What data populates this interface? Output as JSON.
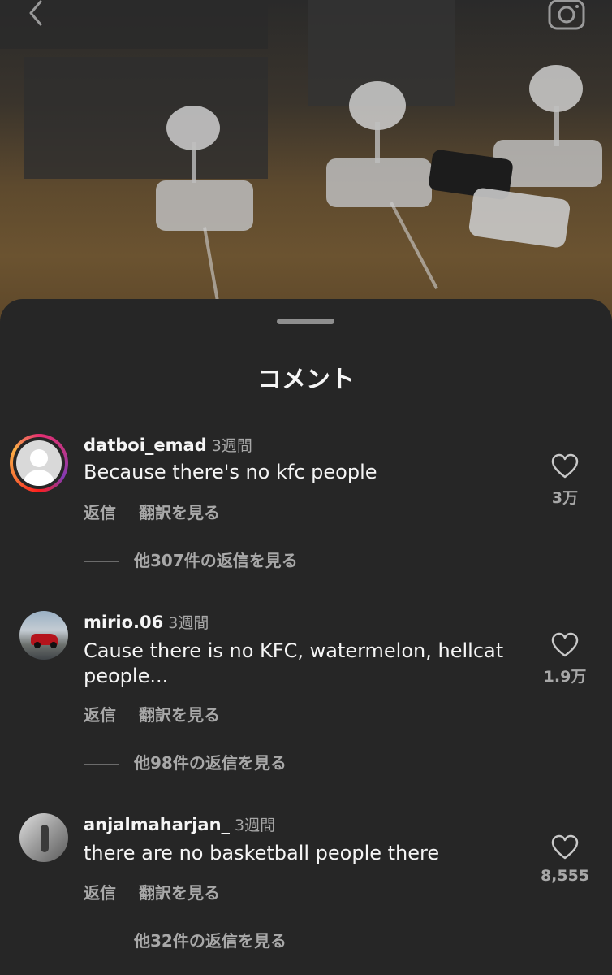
{
  "sheet": {
    "title": "コメント"
  },
  "comments": [
    {
      "username": "datboi_emad",
      "time": "3週間",
      "text": "Because there's no kfc people",
      "reply_label": "返信",
      "translate_label": "翻訳を見る",
      "view_replies": "他307件の返信を見る",
      "likes": "3万"
    },
    {
      "username": "mirio.06",
      "time": "3週間",
      "text": "Cause there is no KFC, watermelon, hellcat people...",
      "reply_label": "返信",
      "translate_label": "翻訳を見る",
      "view_replies": "他98件の返信を見る",
      "likes": "1.9万"
    },
    {
      "username": "anjalmaharjan_",
      "time": "3週間",
      "text": "there are no basketball people there",
      "reply_label": "返信",
      "translate_label": "翻訳を見る",
      "view_replies": "他32件の返信を見る",
      "likes": "8,555"
    }
  ],
  "icons": {
    "back": "chevron-left-icon",
    "camera": "camera-icon",
    "like": "heart-icon"
  },
  "colors": {
    "sheet_bg": "#262626",
    "secondary_text": "#a8a8a8",
    "primary_text": "#f5f5f5"
  }
}
